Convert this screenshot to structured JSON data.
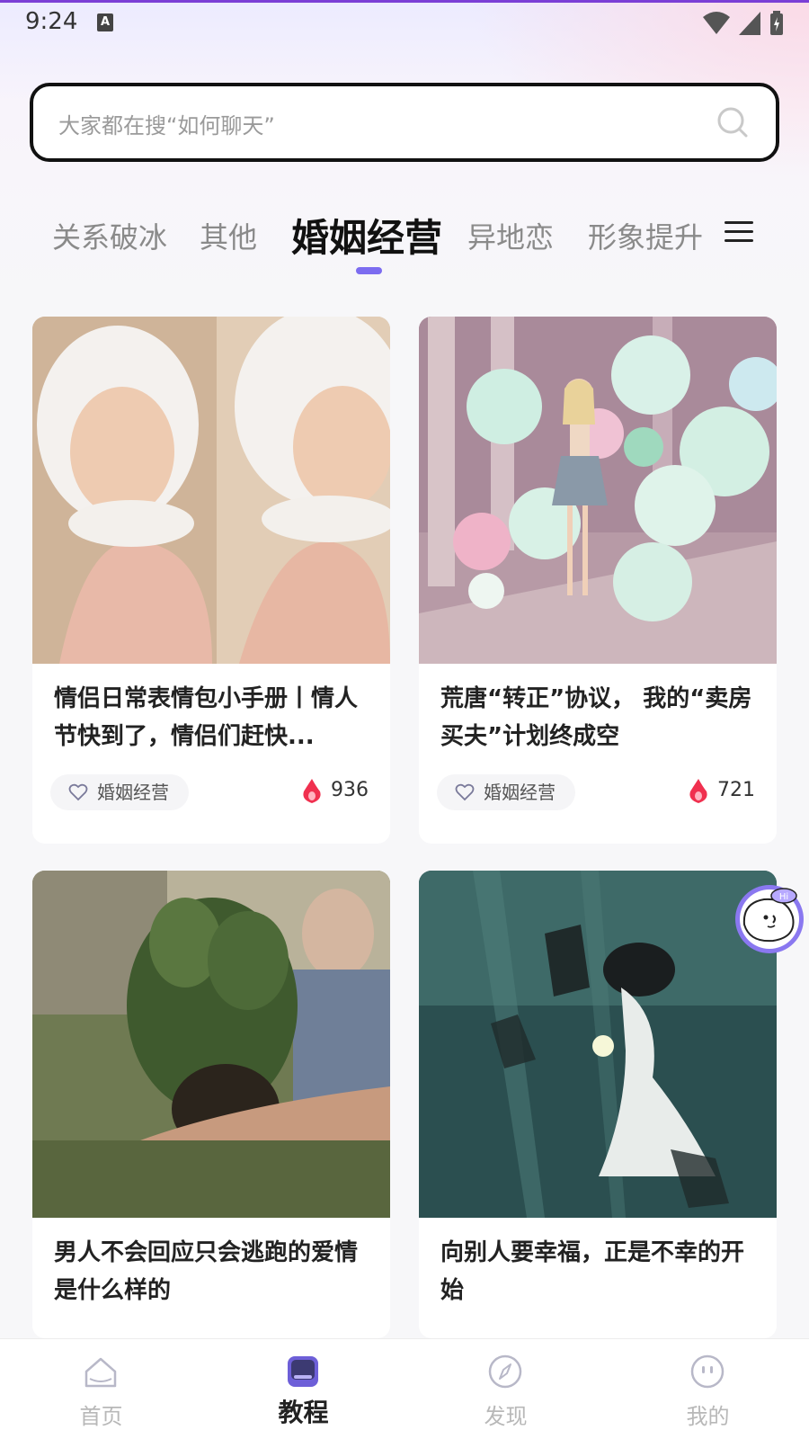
{
  "status_bar": {
    "time": "9:24",
    "notif": "A"
  },
  "search": {
    "placeholder": "大家都在搜“如何聊天”"
  },
  "tabs": [
    {
      "label": "关系破冰"
    },
    {
      "label": "其他"
    },
    {
      "label": "婚姻经营"
    },
    {
      "label": "异地恋"
    },
    {
      "label": "形象提升"
    }
  ],
  "active_tab_index": 2,
  "cards": [
    {
      "title": "情侣日常表情包小手册丨情人节快到了，情侣们赶快...",
      "tag": "婚姻经营",
      "count": "936",
      "image_desc": "girl-white-hood-photo"
    },
    {
      "title": "荒唐“转正”协议， 我的“卖房买夫”计划终成空",
      "tag": "婚姻经营",
      "count": "721",
      "image_desc": "girl-balloons-photo"
    },
    {
      "title": "男人不会回应只会逃跑的爱情是什么样的",
      "image_desc": "hand-holding-plant-photo"
    },
    {
      "title": "向别人要幸福，正是不幸的开始",
      "image_desc": "underwater-woman-photo"
    }
  ],
  "float_bot": {
    "badge": "Hi"
  },
  "bottom_nav": {
    "items": [
      {
        "label": "首页",
        "icon": "home-icon"
      },
      {
        "label": "教程",
        "icon": "tutorial-icon"
      },
      {
        "label": "发现",
        "icon": "compass-icon"
      },
      {
        "label": "我的",
        "icon": "profile-icon"
      }
    ],
    "active_index": 1
  },
  "colors": {
    "accent": "#7c6cf0",
    "heat": "#f0304f"
  }
}
